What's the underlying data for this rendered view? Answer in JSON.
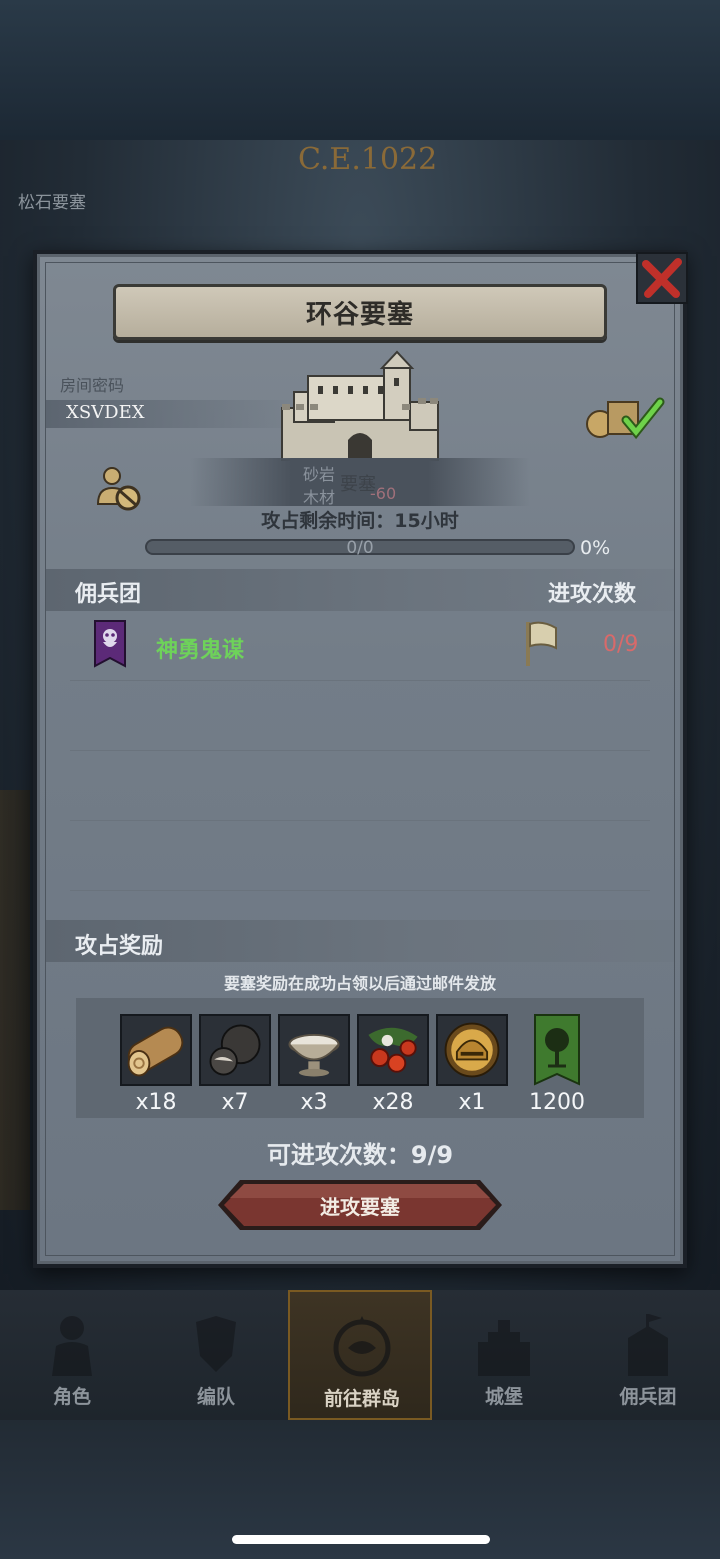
{
  "background": {
    "era": "C.E.1022",
    "location": "松石要塞"
  },
  "dialog": {
    "title": "环谷要塞",
    "room_label": "房间密码",
    "room_code": "XSVDEX",
    "fortress_label": "要塞",
    "resources": [
      {
        "name": "砂岩",
        "value": ""
      },
      {
        "name": "木材",
        "value": "-60"
      }
    ],
    "time_remaining": "攻占剩余时间：15小时",
    "progress": {
      "count": "0/0",
      "percent": "0%",
      "fill_fraction": 0
    }
  },
  "mercenary": {
    "header_left": "佣兵团",
    "header_right": "进攻次数",
    "rows": [
      {
        "name": "神勇鬼谋",
        "attacks": "0/9"
      }
    ]
  },
  "rewards": {
    "header": "攻占奖励",
    "note": "要塞奖励在成功占领以后通过邮件发放",
    "items": [
      {
        "icon": "wood-log-icon",
        "qty": "x18"
      },
      {
        "icon": "truffle-icon",
        "qty": "x7"
      },
      {
        "icon": "silver-bowl-icon",
        "qty": "x3"
      },
      {
        "icon": "berries-icon",
        "qty": "x28"
      },
      {
        "icon": "gold-helmet-icon",
        "qty": "x1"
      },
      {
        "icon": "tree-banner-icon",
        "qty": "1200"
      }
    ]
  },
  "footer": {
    "remaining_attacks": "可进攻次数：9/9",
    "attack_button": "进攻要塞"
  },
  "nav": [
    {
      "label": "角色",
      "icon": "knight-icon"
    },
    {
      "label": "编队",
      "icon": "helmet-shield-icon"
    },
    {
      "label": "前往群岛",
      "icon": "compass-map-icon"
    },
    {
      "label": "城堡",
      "icon": "castle-icon"
    },
    {
      "label": "佣兵团",
      "icon": "flag-castle-icon"
    }
  ],
  "colors": {
    "merc_name": "#6ed25a",
    "attacks_used": "#d86a6a",
    "button": "#7a3630",
    "close": "#c0302a"
  }
}
